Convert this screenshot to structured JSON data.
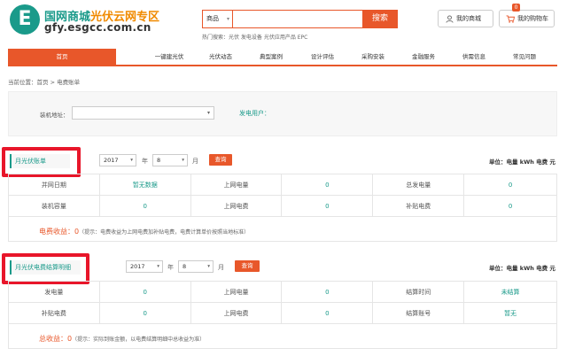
{
  "header": {
    "logo_letter": "E",
    "title_main": "国网商城",
    "title_highlight": "光伏云网专区",
    "domain": "gfy.esgcc.com.cn",
    "search_category": "商品",
    "search_placeholder": "",
    "search_button": "搜索",
    "hot_search": "热门搜索：光伏  发电设备  光伏应用产品  EPC",
    "my_mall": "我的商城",
    "my_cart": "我的购物车",
    "cart_count": "0"
  },
  "nav": {
    "items": [
      "首页",
      "一键建光伏",
      "光伏动态",
      "典型案例",
      "设计评估",
      "采购安装",
      "金融服务",
      "供需信息",
      "常见问题"
    ]
  },
  "breadcrumb": "当前位置：首页 > 电费账单",
  "filter": {
    "address_label": "装机地址：",
    "address_value": "",
    "user_label": "发电用户："
  },
  "monthly_bill": {
    "title": "月光伏账单",
    "year": "2017",
    "year_unit": "年",
    "month": "8",
    "month_unit": "月",
    "query": "查询",
    "unit_note": "单位：电量 kWh  电费 元",
    "rows": [
      [
        "并网日期",
        "暂无数据",
        "上网电量",
        "0",
        "总发电量",
        "0"
      ],
      [
        "装机容量",
        "0",
        "上网电费",
        "0",
        "补贴电费",
        "0"
      ]
    ],
    "income_label": "电费收益：0",
    "income_tip": "（提示：电费收益为上网电费加补贴电费，电费计算单价按照当地标准）"
  },
  "settlement": {
    "title": "月光伏电费结算明细",
    "year": "2017",
    "year_unit": "年",
    "month": "8",
    "month_unit": "月",
    "query": "查询",
    "unit_note": "单位：电量 kWh  电费 元",
    "rows": [
      [
        "发电量",
        "0",
        "上网电量",
        "0",
        "结算时间",
        "未结算"
      ],
      [
        "补贴电费",
        "0",
        "上网电费",
        "0",
        "结算账号",
        "暂无"
      ]
    ],
    "income_label": "总收益：0",
    "income_tip": "（提示：实际到账金额，以电费结算明细中总收益为准）"
  },
  "colors": {
    "accent": "#e8572a",
    "brand": "#1a9a8a",
    "highlight_box": "#e8162a"
  }
}
